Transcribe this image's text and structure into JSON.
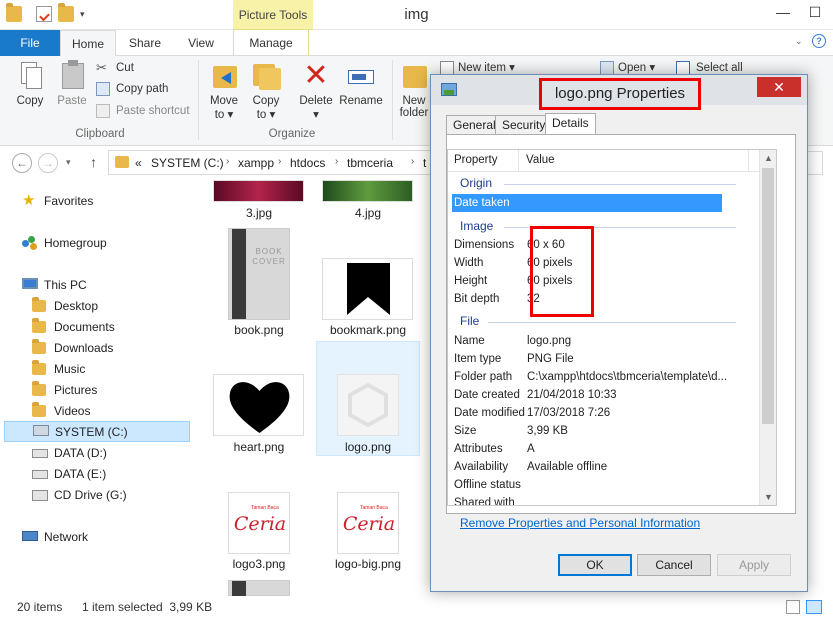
{
  "window": {
    "title": "img",
    "contextual_tab": "Picture Tools"
  },
  "ribbon_tabs": [
    {
      "label": "File"
    },
    {
      "label": "Home"
    },
    {
      "label": "Share"
    },
    {
      "label": "View"
    },
    {
      "label": "Manage"
    }
  ],
  "ribbon": {
    "copy": "Copy",
    "paste": "Paste",
    "cut": "Cut",
    "copy_path": "Copy path",
    "paste_shortcut": "Paste shortcut",
    "clipboard_group": "Clipboard",
    "move_to_1": "Move",
    "move_to_2": "to",
    "copy_to_1": "Copy",
    "copy_to_2": "to",
    "delete": "Delete",
    "rename": "Rename",
    "organize_group": "Organize",
    "new_folder_1": "New",
    "new_folder_2": "folder",
    "new_item": "New item",
    "open": "Open",
    "select_all": "Select all"
  },
  "address": {
    "prefix": "«",
    "crumbs": [
      "SYSTEM (C:)",
      "xampp",
      "htdocs",
      "tbmceria",
      "t"
    ]
  },
  "nav": {
    "favorites": "Favorites",
    "homegroup": "Homegroup",
    "this_pc": "This PC",
    "desktop": "Desktop",
    "documents": "Documents",
    "downloads": "Downloads",
    "music": "Music",
    "pictures": "Pictures",
    "videos": "Videos",
    "system_c": "SYSTEM (C:)",
    "data_d": "DATA (D:)",
    "data_e": "DATA (E:)",
    "cd_drive": "CD Drive (G:)",
    "network": "Network"
  },
  "files": [
    {
      "name": "3.jpg"
    },
    {
      "name": "4.jpg"
    },
    {
      "name": "book.png",
      "thumb_text": "BOOK\nCOVER"
    },
    {
      "name": "bookmark.png"
    },
    {
      "name": "heart.png"
    },
    {
      "name": "logo.png"
    },
    {
      "name": "logo3.png",
      "thumb_text": "Ceria",
      "thumb_small": "Taman Baca"
    },
    {
      "name": "logo-big.png",
      "thumb_text": "Ceria",
      "thumb_small": "Taman Baca"
    }
  ],
  "status": {
    "count": "20 items",
    "selected": "1 item selected  3,99 KB"
  },
  "dialog": {
    "title": "logo.png Properties",
    "close": "✕",
    "tabs": [
      "General",
      "Security",
      "Details"
    ],
    "columns": {
      "property": "Property",
      "value": "Value"
    },
    "sections": {
      "origin": "Origin",
      "image": "Image",
      "file": "File"
    },
    "origin_rows": [
      {
        "k": "Date taken",
        "v": ""
      }
    ],
    "image_rows": [
      {
        "k": "Dimensions",
        "v": "60 x 60"
      },
      {
        "k": "Width",
        "v": "60 pixels"
      },
      {
        "k": "Height",
        "v": "60 pixels"
      },
      {
        "k": "Bit depth",
        "v": "32"
      }
    ],
    "file_rows": [
      {
        "k": "Name",
        "v": "logo.png"
      },
      {
        "k": "Item type",
        "v": "PNG File"
      },
      {
        "k": "Folder path",
        "v": "C:\\xampp\\htdocs\\tbmceria\\template\\d..."
      },
      {
        "k": "Date created",
        "v": "21/04/2018 10:33"
      },
      {
        "k": "Date modified",
        "v": "17/03/2018 7:26"
      },
      {
        "k": "Size",
        "v": "3,99 KB"
      },
      {
        "k": "Attributes",
        "v": "A"
      },
      {
        "k": "Availability",
        "v": "Available offline"
      },
      {
        "k": "Offline status",
        "v": ""
      },
      {
        "k": "Shared with",
        "v": ""
      }
    ],
    "remove_link": "Remove Properties and Personal Information",
    "ok": "OK",
    "cancel": "Cancel",
    "apply": "Apply"
  },
  "colors": {
    "accent": "#1979ca",
    "highlight": "#e00000",
    "selection": "#3399ff"
  }
}
